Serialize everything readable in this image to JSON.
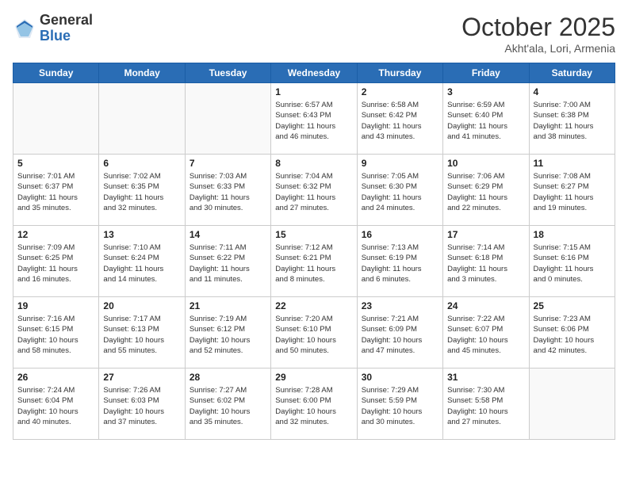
{
  "header": {
    "logo_general": "General",
    "logo_blue": "Blue",
    "month": "October 2025",
    "location": "Akht'ala, Lori, Armenia"
  },
  "days_of_week": [
    "Sunday",
    "Monday",
    "Tuesday",
    "Wednesday",
    "Thursday",
    "Friday",
    "Saturday"
  ],
  "weeks": [
    [
      {
        "num": "",
        "text": ""
      },
      {
        "num": "",
        "text": ""
      },
      {
        "num": "",
        "text": ""
      },
      {
        "num": "1",
        "text": "Sunrise: 6:57 AM\nSunset: 6:43 PM\nDaylight: 11 hours\nand 46 minutes."
      },
      {
        "num": "2",
        "text": "Sunrise: 6:58 AM\nSunset: 6:42 PM\nDaylight: 11 hours\nand 43 minutes."
      },
      {
        "num": "3",
        "text": "Sunrise: 6:59 AM\nSunset: 6:40 PM\nDaylight: 11 hours\nand 41 minutes."
      },
      {
        "num": "4",
        "text": "Sunrise: 7:00 AM\nSunset: 6:38 PM\nDaylight: 11 hours\nand 38 minutes."
      }
    ],
    [
      {
        "num": "5",
        "text": "Sunrise: 7:01 AM\nSunset: 6:37 PM\nDaylight: 11 hours\nand 35 minutes."
      },
      {
        "num": "6",
        "text": "Sunrise: 7:02 AM\nSunset: 6:35 PM\nDaylight: 11 hours\nand 32 minutes."
      },
      {
        "num": "7",
        "text": "Sunrise: 7:03 AM\nSunset: 6:33 PM\nDaylight: 11 hours\nand 30 minutes."
      },
      {
        "num": "8",
        "text": "Sunrise: 7:04 AM\nSunset: 6:32 PM\nDaylight: 11 hours\nand 27 minutes."
      },
      {
        "num": "9",
        "text": "Sunrise: 7:05 AM\nSunset: 6:30 PM\nDaylight: 11 hours\nand 24 minutes."
      },
      {
        "num": "10",
        "text": "Sunrise: 7:06 AM\nSunset: 6:29 PM\nDaylight: 11 hours\nand 22 minutes."
      },
      {
        "num": "11",
        "text": "Sunrise: 7:08 AM\nSunset: 6:27 PM\nDaylight: 11 hours\nand 19 minutes."
      }
    ],
    [
      {
        "num": "12",
        "text": "Sunrise: 7:09 AM\nSunset: 6:25 PM\nDaylight: 11 hours\nand 16 minutes."
      },
      {
        "num": "13",
        "text": "Sunrise: 7:10 AM\nSunset: 6:24 PM\nDaylight: 11 hours\nand 14 minutes."
      },
      {
        "num": "14",
        "text": "Sunrise: 7:11 AM\nSunset: 6:22 PM\nDaylight: 11 hours\nand 11 minutes."
      },
      {
        "num": "15",
        "text": "Sunrise: 7:12 AM\nSunset: 6:21 PM\nDaylight: 11 hours\nand 8 minutes."
      },
      {
        "num": "16",
        "text": "Sunrise: 7:13 AM\nSunset: 6:19 PM\nDaylight: 11 hours\nand 6 minutes."
      },
      {
        "num": "17",
        "text": "Sunrise: 7:14 AM\nSunset: 6:18 PM\nDaylight: 11 hours\nand 3 minutes."
      },
      {
        "num": "18",
        "text": "Sunrise: 7:15 AM\nSunset: 6:16 PM\nDaylight: 11 hours\nand 0 minutes."
      }
    ],
    [
      {
        "num": "19",
        "text": "Sunrise: 7:16 AM\nSunset: 6:15 PM\nDaylight: 10 hours\nand 58 minutes."
      },
      {
        "num": "20",
        "text": "Sunrise: 7:17 AM\nSunset: 6:13 PM\nDaylight: 10 hours\nand 55 minutes."
      },
      {
        "num": "21",
        "text": "Sunrise: 7:19 AM\nSunset: 6:12 PM\nDaylight: 10 hours\nand 52 minutes."
      },
      {
        "num": "22",
        "text": "Sunrise: 7:20 AM\nSunset: 6:10 PM\nDaylight: 10 hours\nand 50 minutes."
      },
      {
        "num": "23",
        "text": "Sunrise: 7:21 AM\nSunset: 6:09 PM\nDaylight: 10 hours\nand 47 minutes."
      },
      {
        "num": "24",
        "text": "Sunrise: 7:22 AM\nSunset: 6:07 PM\nDaylight: 10 hours\nand 45 minutes."
      },
      {
        "num": "25",
        "text": "Sunrise: 7:23 AM\nSunset: 6:06 PM\nDaylight: 10 hours\nand 42 minutes."
      }
    ],
    [
      {
        "num": "26",
        "text": "Sunrise: 7:24 AM\nSunset: 6:04 PM\nDaylight: 10 hours\nand 40 minutes."
      },
      {
        "num": "27",
        "text": "Sunrise: 7:26 AM\nSunset: 6:03 PM\nDaylight: 10 hours\nand 37 minutes."
      },
      {
        "num": "28",
        "text": "Sunrise: 7:27 AM\nSunset: 6:02 PM\nDaylight: 10 hours\nand 35 minutes."
      },
      {
        "num": "29",
        "text": "Sunrise: 7:28 AM\nSunset: 6:00 PM\nDaylight: 10 hours\nand 32 minutes."
      },
      {
        "num": "30",
        "text": "Sunrise: 7:29 AM\nSunset: 5:59 PM\nDaylight: 10 hours\nand 30 minutes."
      },
      {
        "num": "31",
        "text": "Sunrise: 7:30 AM\nSunset: 5:58 PM\nDaylight: 10 hours\nand 27 minutes."
      },
      {
        "num": "",
        "text": ""
      }
    ]
  ]
}
